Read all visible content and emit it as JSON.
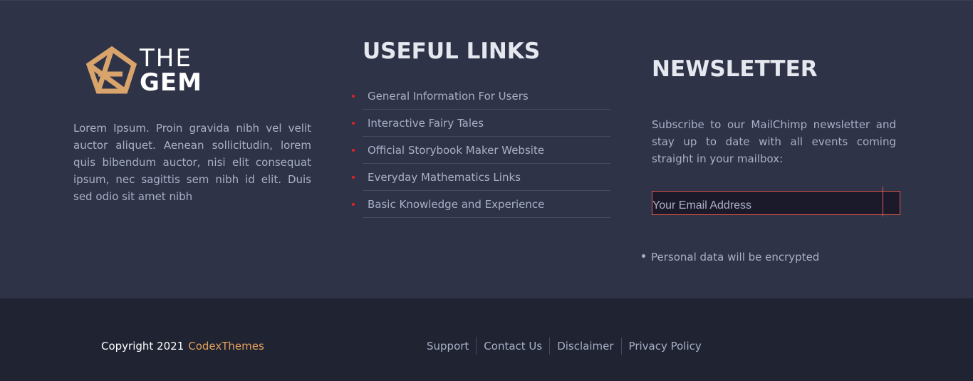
{
  "logo": {
    "line1": "THE",
    "line2": "GEM",
    "accent_color": "#d9a46b"
  },
  "about": {
    "text": "Lorem Ipsum. Proin gravida nibh vel velit auctor aliquet. Aenean sollicitudin, lorem quis bibendum auctor, nisi elit consequat ipsum, nec sagittis sem nibh id elit. Duis sed odio sit amet nibh"
  },
  "useful_links": {
    "title": "USEFUL LINKS",
    "items": [
      {
        "label": "General Information For Users"
      },
      {
        "label": "Interactive Fairy Tales"
      },
      {
        "label": "Official Storybook Maker Website"
      },
      {
        "label": "Everyday Mathematics Links"
      },
      {
        "label": "Basic Knowledge and Experience"
      }
    ]
  },
  "newsletter": {
    "title": "NEWSLETTER",
    "text": "Subscribe to our MailChimp newsletter and stay up to date with all events coming straight in your mailbox:",
    "email_placeholder": "Your Email Address",
    "email_value": "",
    "note": "Personal data will be encrypted"
  },
  "bottom_bar": {
    "copyright": "Copyright 2021",
    "brand": "CodexThemes",
    "links": [
      {
        "label": "Support"
      },
      {
        "label": "Contact Us"
      },
      {
        "label": "Disclaimer"
      },
      {
        "label": "Privacy Policy"
      }
    ]
  },
  "colors": {
    "main_bg": "#2e3348",
    "bottom_bg": "#1f2332",
    "bullet": "#e0212a",
    "input_border": "#e0584c",
    "brand": "#e5a05c"
  }
}
